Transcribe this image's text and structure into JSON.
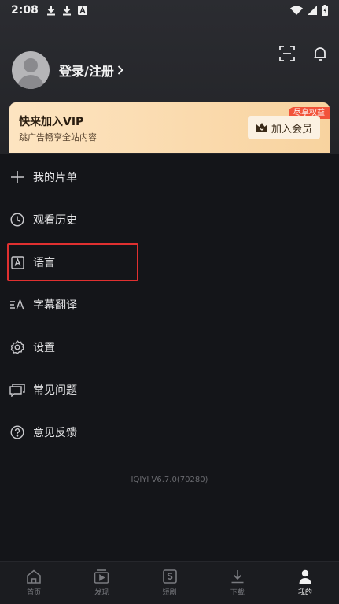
{
  "status_bar": {
    "time": "2:08",
    "left_icons": [
      "download-icon",
      "download-icon",
      "a-box-icon"
    ],
    "right_icons": [
      "wifi-icon",
      "signal-icon",
      "battery-icon"
    ]
  },
  "header": {
    "actions": [
      "scan-icon",
      "bell-icon"
    ]
  },
  "profile": {
    "login_label": "登录/注册"
  },
  "vip": {
    "title": "快来加入VIP",
    "subtitle": "跳广告畅享全站内容",
    "badge": "尽享权益",
    "button_label": "加入会员",
    "colors": {
      "card_start": "#fde4c1",
      "card_end": "#f8d39f",
      "badge": "#f2533a"
    }
  },
  "menu": {
    "items": [
      {
        "label": "我的片单",
        "icon": "plus-icon"
      },
      {
        "label": "观看历史",
        "icon": "clock-icon"
      },
      {
        "label": "语言",
        "icon": "language-icon"
      },
      {
        "label": "字幕翻译",
        "icon": "subtitle-icon"
      },
      {
        "label": "设置",
        "icon": "gear-icon"
      },
      {
        "label": "常见问题",
        "icon": "chat-icon"
      },
      {
        "label": "意见反馈",
        "icon": "question-icon"
      }
    ]
  },
  "version": "IQIYI V6.7.0(70280)",
  "bottom_nav": {
    "items": [
      {
        "label": "首页",
        "icon": "home-icon",
        "active": false
      },
      {
        "label": "发现",
        "icon": "play-box-icon",
        "active": false
      },
      {
        "label": "短剧",
        "icon": "short-drama-icon",
        "active": false
      },
      {
        "label": "下载",
        "icon": "download-icon",
        "active": false
      },
      {
        "label": "我的",
        "icon": "user-icon",
        "active": true
      }
    ]
  },
  "colors": {
    "background": "#141519",
    "highlight": "#e03030"
  }
}
